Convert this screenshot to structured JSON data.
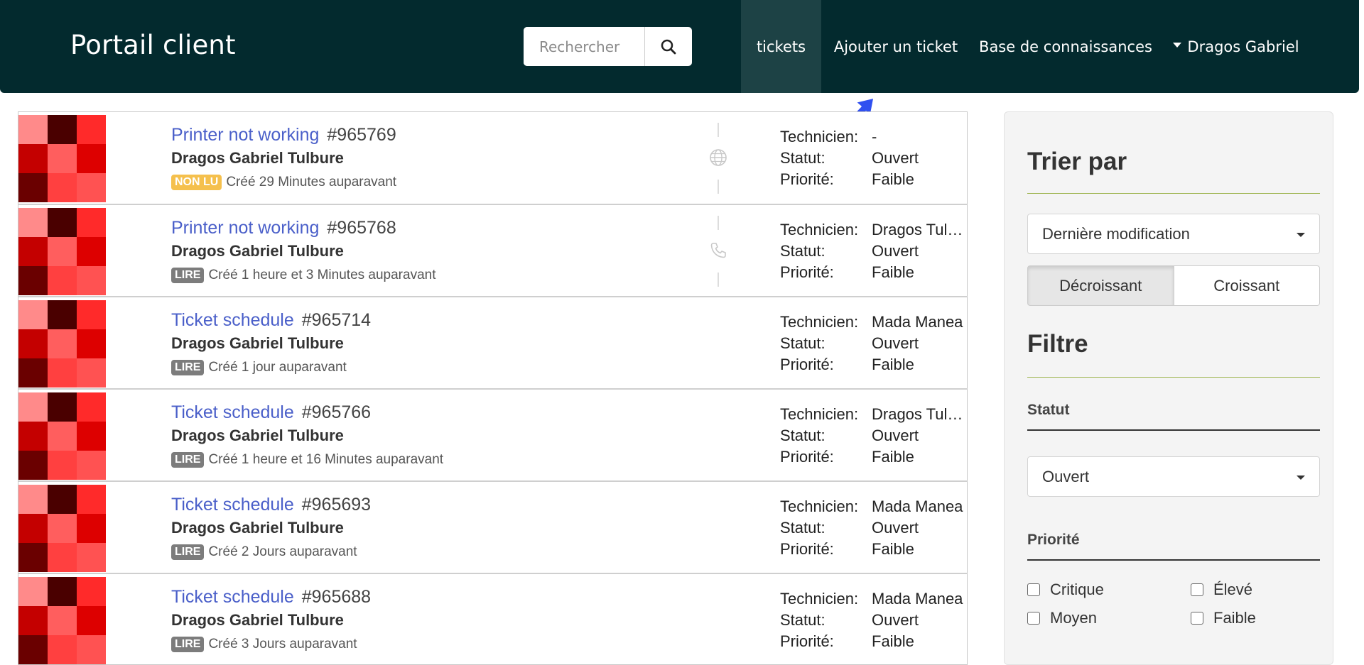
{
  "header": {
    "brand": "Portail client",
    "search": {
      "placeholder": "Rechercher"
    },
    "nav": {
      "tickets": "tickets",
      "add_ticket": "Ajouter un ticket",
      "knowledge_base": "Base de connaissances",
      "user": "Dragos Gabriel"
    }
  },
  "tickets": [
    {
      "title": "Printer not working",
      "number": "#965769",
      "author": "Dragos Gabriel Tulbure",
      "badge": "NON LU",
      "badge_state": "unread",
      "created": "Créé 29 Minutes auparavant",
      "channel": "globe-icon",
      "technicien_label": "Technicien:",
      "technicien": "-",
      "statut_label": "Statut:",
      "statut": "Ouvert",
      "priorite_label": "Priorité:",
      "priorite": "Faible"
    },
    {
      "title": "Printer not working",
      "number": "#965768",
      "author": "Dragos Gabriel Tulbure",
      "badge": "LIRE",
      "badge_state": "read",
      "created": "Créé 1 heure et 3 Minutes auparavant",
      "channel": "phone-icon",
      "technicien_label": "Technicien:",
      "technicien": "Dragos Tulbure",
      "statut_label": "Statut:",
      "statut": "Ouvert",
      "priorite_label": "Priorité:",
      "priorite": "Faible"
    },
    {
      "title": "Ticket schedule",
      "number": "#965714",
      "author": "Dragos Gabriel Tulbure",
      "badge": "LIRE",
      "badge_state": "read",
      "created": "Créé 1 jour auparavant",
      "channel": "",
      "technicien_label": "Technicien:",
      "technicien": "Mada Manea",
      "statut_label": "Statut:",
      "statut": "Ouvert",
      "priorite_label": "Priorité:",
      "priorite": "Faible"
    },
    {
      "title": "Ticket schedule",
      "number": "#965766",
      "author": "Dragos Gabriel Tulbure",
      "badge": "LIRE",
      "badge_state": "read",
      "created": "Créé 1 heure et 16 Minutes auparavant",
      "channel": "",
      "technicien_label": "Technicien:",
      "technicien": "Dragos Tulbure",
      "statut_label": "Statut:",
      "statut": "Ouvert",
      "priorite_label": "Priorité:",
      "priorite": "Faible"
    },
    {
      "title": "Ticket schedule",
      "number": "#965693",
      "author": "Dragos Gabriel Tulbure",
      "badge": "LIRE",
      "badge_state": "read",
      "created": "Créé 2 Jours auparavant",
      "channel": "",
      "technicien_label": "Technicien:",
      "technicien": "Mada Manea",
      "statut_label": "Statut:",
      "statut": "Ouvert",
      "priorite_label": "Priorité:",
      "priorite": "Faible"
    },
    {
      "title": "Ticket schedule",
      "number": "#965688",
      "author": "Dragos Gabriel Tulbure",
      "badge": "LIRE",
      "badge_state": "read",
      "created": "Créé 3 Jours auparavant",
      "channel": "",
      "technicien_label": "Technicien:",
      "technicien": "Mada Manea",
      "statut_label": "Statut:",
      "statut": "Ouvert",
      "priorite_label": "Priorité:",
      "priorite": "Faible"
    }
  ],
  "avatar_colors": [
    "#ff8a8a",
    "#4a0000",
    "#ff2a2a",
    "#c40000",
    "#ff5e5e",
    "#dd0000",
    "#6a0000",
    "#ff4040",
    "#ff5252"
  ],
  "sidebar": {
    "sort_title": "Trier par",
    "sort_select": "Dernière modification",
    "order_desc": "Décroissant",
    "order_asc": "Croissant",
    "filter_title": "Filtre",
    "status_label": "Statut",
    "status_select": "Ouvert",
    "priority_label": "Priorité",
    "priorities": [
      "Critique",
      "Élevé",
      "Moyen",
      "Faible"
    ]
  },
  "colors": {
    "header_bg": "#032a2e",
    "link": "#4a5fc9",
    "unread_badge": "#f5c04d",
    "read_badge": "#7c7c7c",
    "rule": "#9bb34a"
  }
}
